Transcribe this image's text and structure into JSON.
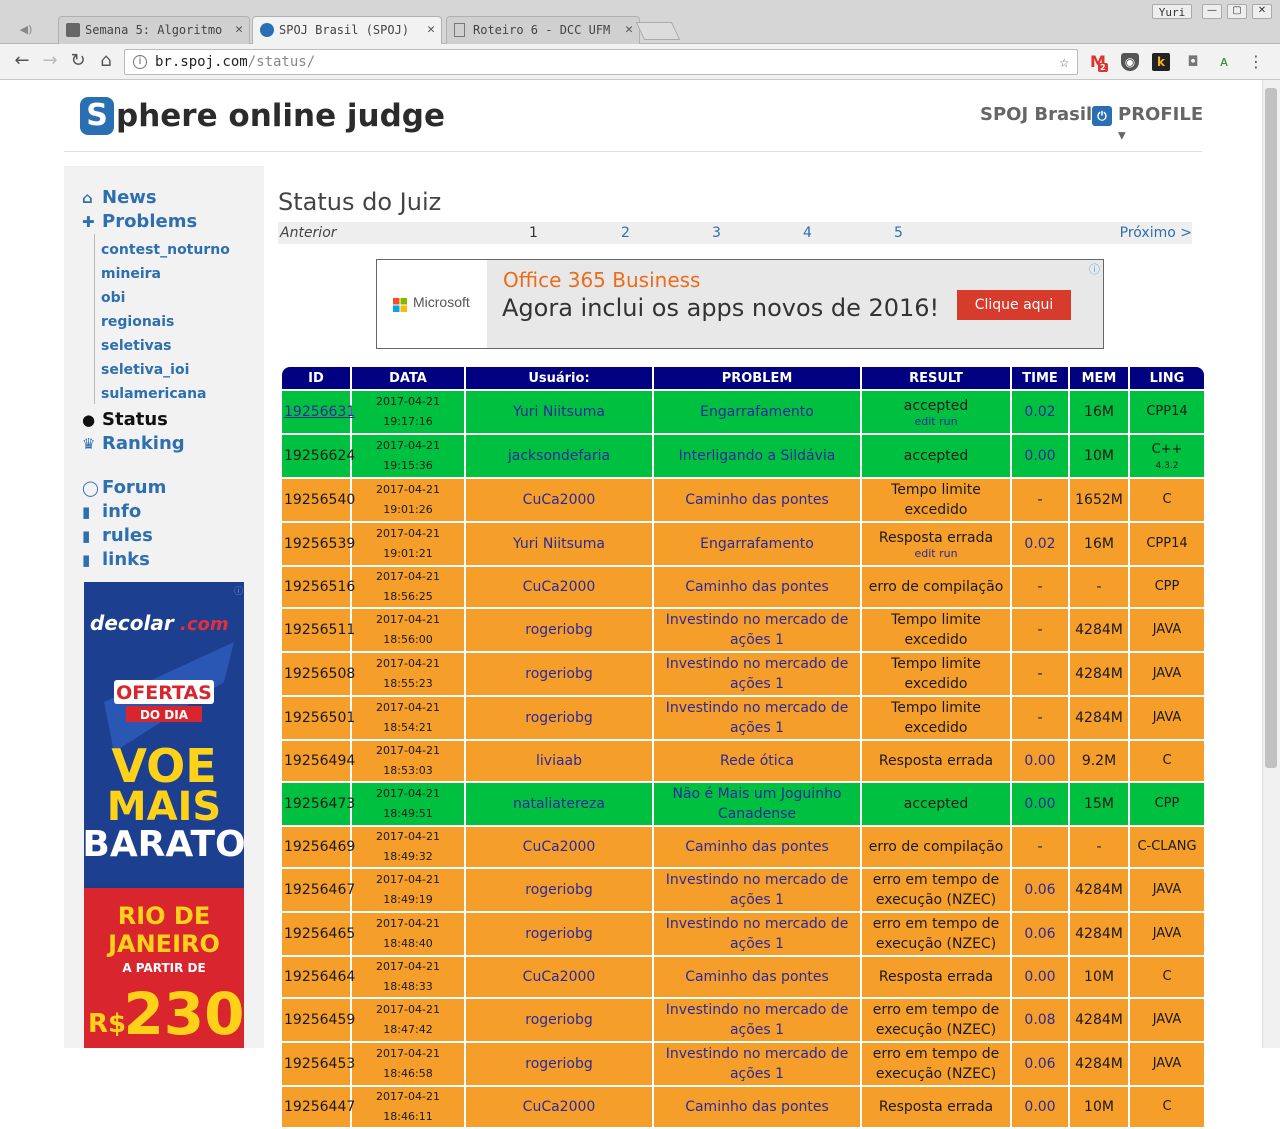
{
  "browser": {
    "user": "Yuri",
    "tabs": [
      {
        "label": "Semana 5: Algoritmo"
      },
      {
        "label": "SPOJ Brasil (SPOJ)"
      },
      {
        "label": "Roteiro 6 - DCC UFM"
      }
    ],
    "url_host": "br.spoj.com",
    "url_path": "/status/",
    "extensions": [
      {
        "label": "2"
      }
    ]
  },
  "header": {
    "logo": "phere online judge",
    "logo_letter": "S",
    "site": "SPOJ Brasil",
    "profile": "PROFILE"
  },
  "sidebar": {
    "news": "News",
    "problems": "Problems",
    "subs": [
      "contest_noturno",
      "mineira",
      "obi",
      "regionais",
      "seletivas",
      "seletiva_ioi",
      "sulamericana"
    ],
    "status": "Status",
    "ranking": "Ranking",
    "forum": "Forum",
    "info": "info",
    "rules": "rules",
    "links": "links"
  },
  "page": {
    "title": "Status do Juiz"
  },
  "pager": {
    "prev": "Anterior",
    "pages": [
      "1",
      "2",
      "3",
      "4",
      "5"
    ],
    "next": "Próximo >"
  },
  "top_ad": {
    "brand": "Microsoft",
    "headline": "Office 365 Business",
    "subline": "Agora inclui os apps novos de 2016!",
    "button": "Clique aqui"
  },
  "side_ad": {
    "brand": "decolar",
    "brand_suffix": ".com",
    "badge1": "OFERTAS",
    "badge2": "DO DIA",
    "line1": "VOE",
    "line2": "MAIS",
    "line3": "BARATO",
    "city1": "RIO DE",
    "city2": "JANEIRO",
    "from": "A PARTIR DE",
    "currency": "R$",
    "price": "230"
  },
  "table": {
    "headers": [
      "ID",
      "DATA",
      "Usuário:",
      "PROBLEM",
      "RESULT",
      "TIME",
      "MEM",
      "LING"
    ],
    "extra_edit": "edit",
    "extra_run": "run",
    "rows": [
      {
        "id": "19256631",
        "date": "2017-04-21 19:17:16",
        "user": "Yuri Niitsuma",
        "problem": "Engarrafamento",
        "result": "accepted",
        "time": "0.02",
        "mem": "16M",
        "lang": "CPP14",
        "status": "ok",
        "editrun": true,
        "idlink": true
      },
      {
        "id": "19256624",
        "date": "2017-04-21 19:15:36",
        "user": "jacksondefaria",
        "problem": "Interligando a Sildávia",
        "result": "accepted",
        "time": "0.00",
        "mem": "10M",
        "lang": "C++",
        "langver": "4.3.2",
        "status": "ok"
      },
      {
        "id": "19256540",
        "date": "2017-04-21 19:01:26",
        "user": "CuCa2000",
        "problem": "Caminho das pontes",
        "result": "Tempo limite excedido",
        "time": "-",
        "mem": "1652M",
        "lang": "C",
        "status": "er"
      },
      {
        "id": "19256539",
        "date": "2017-04-21 19:01:21",
        "user": "Yuri Niitsuma",
        "problem": "Engarrafamento",
        "result": "Resposta errada",
        "time": "0.02",
        "mem": "16M",
        "lang": "CPP14",
        "status": "er",
        "editrun": true
      },
      {
        "id": "19256516",
        "date": "2017-04-21 18:56:25",
        "user": "CuCa2000",
        "problem": "Caminho das pontes",
        "result": "erro de compilação",
        "time": "-",
        "mem": "-",
        "lang": "CPP",
        "status": "er"
      },
      {
        "id": "19256511",
        "date": "2017-04-21 18:56:00",
        "user": "rogeriobg",
        "problem": "Investindo no mercado de ações 1",
        "result": "Tempo limite excedido",
        "time": "-",
        "mem": "4284M",
        "lang": "JAVA",
        "status": "er"
      },
      {
        "id": "19256508",
        "date": "2017-04-21 18:55:23",
        "user": "rogeriobg",
        "problem": "Investindo no mercado de ações 1",
        "result": "Tempo limite excedido",
        "time": "-",
        "mem": "4284M",
        "lang": "JAVA",
        "status": "er"
      },
      {
        "id": "19256501",
        "date": "2017-04-21 18:54:21",
        "user": "rogeriobg",
        "problem": "Investindo no mercado de ações 1",
        "result": "Tempo limite excedido",
        "time": "-",
        "mem": "4284M",
        "lang": "JAVA",
        "status": "er"
      },
      {
        "id": "19256494",
        "date": "2017-04-21 18:53:03",
        "user": "liviaab",
        "problem": "Rede ótica",
        "result": "Resposta errada",
        "time": "0.00",
        "mem": "9.2M",
        "lang": "C",
        "status": "er"
      },
      {
        "id": "19256473",
        "date": "2017-04-21 18:49:51",
        "user": "nataliatereza",
        "problem": "Não é Mais um Joguinho Canadense",
        "result": "accepted",
        "time": "0.00",
        "mem": "15M",
        "lang": "CPP",
        "status": "ok"
      },
      {
        "id": "19256469",
        "date": "2017-04-21 18:49:32",
        "user": "CuCa2000",
        "problem": "Caminho das pontes",
        "result": "erro de compilação",
        "time": "-",
        "mem": "-",
        "lang": "C-CLANG",
        "status": "er"
      },
      {
        "id": "19256467",
        "date": "2017-04-21 18:49:19",
        "user": "rogeriobg",
        "problem": "Investindo no mercado de ações 1",
        "result": "erro em tempo de execução (NZEC)",
        "time": "0.06",
        "mem": "4284M",
        "lang": "JAVA",
        "status": "er"
      },
      {
        "id": "19256465",
        "date": "2017-04-21 18:48:40",
        "user": "rogeriobg",
        "problem": "Investindo no mercado de ações 1",
        "result": "erro em tempo de execução (NZEC)",
        "time": "0.06",
        "mem": "4284M",
        "lang": "JAVA",
        "status": "er"
      },
      {
        "id": "19256464",
        "date": "2017-04-21 18:48:33",
        "user": "CuCa2000",
        "problem": "Caminho das pontes",
        "result": "Resposta errada",
        "time": "0.00",
        "mem": "10M",
        "lang": "C",
        "status": "er"
      },
      {
        "id": "19256459",
        "date": "2017-04-21 18:47:42",
        "user": "rogeriobg",
        "problem": "Investindo no mercado de ações 1",
        "result": "erro em tempo de execução (NZEC)",
        "time": "0.08",
        "mem": "4284M",
        "lang": "JAVA",
        "status": "er"
      },
      {
        "id": "19256453",
        "date": "2017-04-21 18:46:58",
        "user": "rogeriobg",
        "problem": "Investindo no mercado de ações 1",
        "result": "erro em tempo de execução (NZEC)",
        "time": "0.06",
        "mem": "4284M",
        "lang": "JAVA",
        "status": "er"
      },
      {
        "id": "19256447",
        "date": "2017-04-21 18:46:11",
        "user": "CuCa2000",
        "problem": "Caminho das pontes",
        "result": "Resposta errada",
        "time": "0.00",
        "mem": "10M",
        "lang": "C",
        "status": "er"
      }
    ]
  },
  "colors": {
    "accepted": "#00c040",
    "error": "#f59e2a",
    "header": "#000080",
    "link": "#2e6fb0"
  }
}
